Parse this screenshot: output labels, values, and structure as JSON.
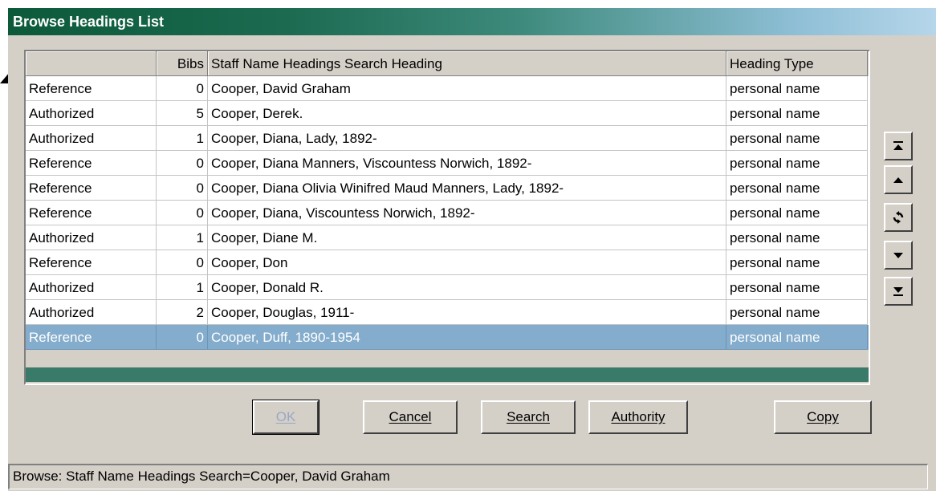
{
  "window": {
    "title": "Browse Headings List"
  },
  "columns": {
    "status": "",
    "bibs": "Bibs",
    "heading": "Staff Name Headings Search Heading",
    "type": "Heading Type"
  },
  "rows": [
    {
      "status": "Reference",
      "bibs": "0",
      "heading": "Cooper, David Graham",
      "type": "personal name",
      "selected": false
    },
    {
      "status": "Authorized",
      "bibs": "5",
      "heading": "Cooper, Derek.",
      "type": "personal name",
      "selected": false
    },
    {
      "status": "Authorized",
      "bibs": "1",
      "heading": "Cooper, Diana, Lady, 1892-",
      "type": "personal name",
      "selected": false
    },
    {
      "status": "Reference",
      "bibs": "0",
      "heading": "Cooper, Diana Manners, Viscountess Norwich, 1892-",
      "type": "personal name",
      "selected": false
    },
    {
      "status": "Reference",
      "bibs": "0",
      "heading": "Cooper, Diana Olivia Winifred Maud Manners, Lady, 1892-",
      "type": "personal name",
      "selected": false
    },
    {
      "status": "Reference",
      "bibs": "0",
      "heading": "Cooper, Diana, Viscountess Norwich, 1892-",
      "type": "personal name",
      "selected": false
    },
    {
      "status": "Authorized",
      "bibs": "1",
      "heading": "Cooper, Diane M.",
      "type": "personal name",
      "selected": false
    },
    {
      "status": "Reference",
      "bibs": "0",
      "heading": "Cooper, Don",
      "type": "personal name",
      "selected": false
    },
    {
      "status": "Authorized",
      "bibs": "1",
      "heading": "Cooper, Donald R.",
      "type": "personal name",
      "selected": false
    },
    {
      "status": "Authorized",
      "bibs": "2",
      "heading": "Cooper, Douglas, 1911-",
      "type": "personal name",
      "selected": false
    },
    {
      "status": "Reference",
      "bibs": "0",
      "heading": "Cooper, Duff, 1890-1954",
      "type": "personal name",
      "selected": true
    }
  ],
  "nav_icons": [
    "scroll-to-top-icon",
    "page-up-icon",
    "refresh-icon",
    "page-down-icon",
    "scroll-to-bottom-icon"
  ],
  "buttons": {
    "ok": "OK",
    "cancel": "Cancel",
    "search": "Search",
    "authority": "Authority",
    "copy": "Copy"
  },
  "status": {
    "text": "Browse: Staff Name Headings Search=Cooper, David Graham"
  },
  "colors": {
    "title_start": "#0c5a3a",
    "title_end": "#b6d6ea",
    "selected_row": "#84accc",
    "grid_footer": "#3a7a68",
    "face": "#d4d0c8"
  }
}
